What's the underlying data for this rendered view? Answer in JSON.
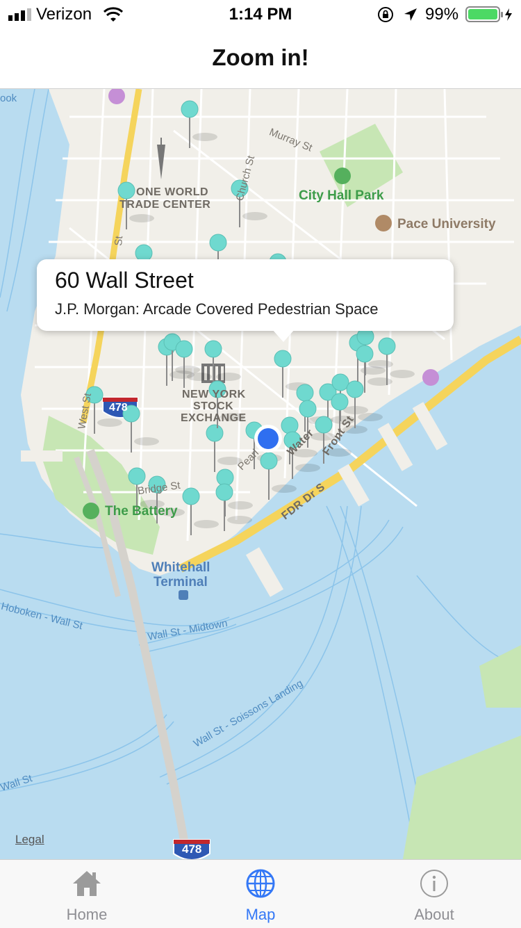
{
  "status_bar": {
    "carrier": "Verizon",
    "time": "1:14 PM",
    "battery_pct": "99%"
  },
  "nav": {
    "title": "Zoom in!"
  },
  "map": {
    "labels": {
      "one_world": "ONE WORLD",
      "trade_center": "TRADE CENTER",
      "city_hall_park": "City Hall Park",
      "pace_university": "Pace University",
      "nyse_1": "NEW YORK",
      "nyse_2": "STOCK",
      "nyse_3": "EXCHANGE",
      "the_battery": "The Battery",
      "whitehall_1": "Whitehall",
      "whitehall_2": "Terminal",
      "murray_st": "Murray St",
      "church_st": "Church St",
      "west_st": "West St",
      "fdr_dr": "FDR Dr S",
      "front_st": "Front St",
      "water_st": "Water",
      "pearl_st": "Pearl",
      "bridge_st": "Bridge St",
      "hoboken_wall_st": "Hoboken - Wall St",
      "wall_st_midtown": "Wall St - Midtown",
      "wall_st_soissons": "Wall St - Soissons Landing",
      "wall_st": "Wall St",
      "i478_top": "478",
      "i478_bottom": "478",
      "brook": "ook",
      "greenwich": "St"
    },
    "callout": {
      "title": "60 Wall Street",
      "subtitle": "J.P. Morgan: Arcade Covered Pedestrian Space"
    },
    "legal": "Legal"
  },
  "tabs": [
    {
      "label": "Home",
      "icon": "house-icon",
      "active": false
    },
    {
      "label": "Map",
      "icon": "globe-icon",
      "active": true
    },
    {
      "label": "About",
      "icon": "info-icon",
      "active": false
    }
  ],
  "colors": {
    "accent": "#3478f6",
    "pin": "#6fd9cf",
    "water": "#b9dcf0",
    "land": "#f1efe9",
    "park": "#c7e6b4",
    "highway": "#f5d45c",
    "user_location": "#2f6ff0"
  }
}
